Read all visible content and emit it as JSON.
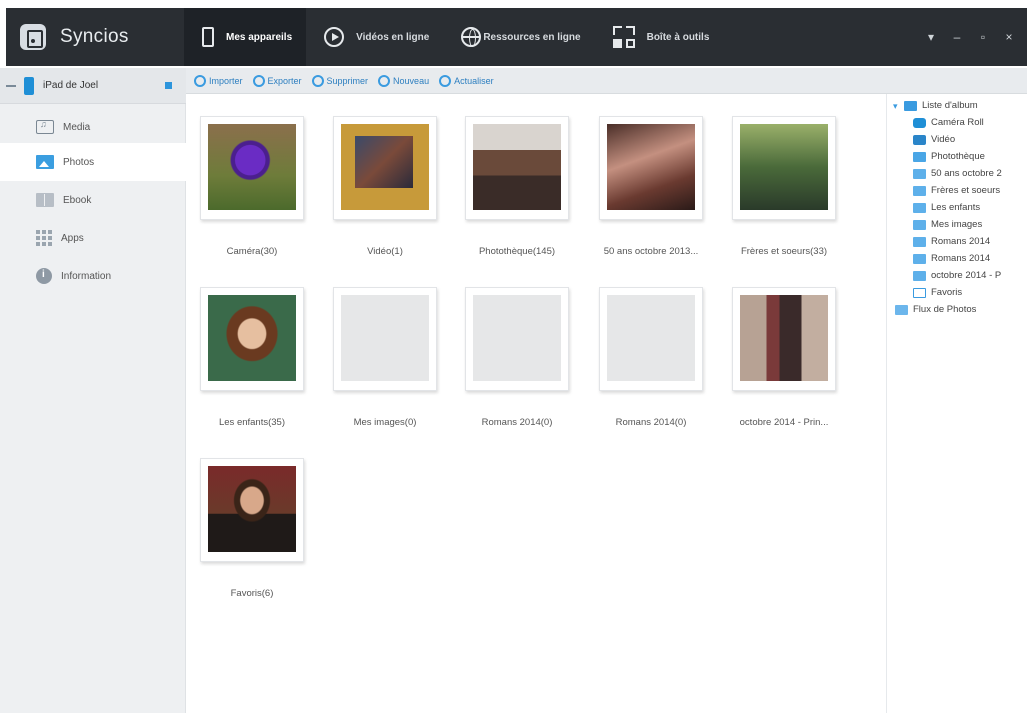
{
  "app": {
    "name": "Syncios"
  },
  "nav": {
    "items": [
      {
        "label": "Mes appareils",
        "icon": "phone-icon",
        "active": true
      },
      {
        "label": "Vidéos en ligne",
        "icon": "play-icon",
        "active": false
      },
      {
        "label": "Ressources en ligne",
        "icon": "globe-icon",
        "active": false
      },
      {
        "label": "Boîte à outils",
        "icon": "toolbox-icon",
        "active": false
      }
    ]
  },
  "window_controls": {
    "menu": "▾",
    "minimize": "–",
    "maximize": "▫",
    "close": "×"
  },
  "sidebar": {
    "device_name": "iPad de Joel",
    "items": [
      {
        "label": "Media",
        "icon": "music-icon",
        "active": false
      },
      {
        "label": "Photos",
        "icon": "photo-icon",
        "active": true
      },
      {
        "label": "Ebook",
        "icon": "book-icon",
        "active": false
      },
      {
        "label": "Apps",
        "icon": "apps-icon",
        "active": false
      },
      {
        "label": "Information",
        "icon": "info-icon",
        "active": false
      }
    ]
  },
  "toolbar": {
    "buttons": [
      {
        "label": "Importer"
      },
      {
        "label": "Exporter"
      },
      {
        "label": "Supprimer"
      },
      {
        "label": "Nouveau"
      },
      {
        "label": "Actualiser"
      }
    ]
  },
  "albums": [
    {
      "caption": "Caméra(30)",
      "thumb": "flower"
    },
    {
      "caption": "Vidéo(1)",
      "thumb": "video"
    },
    {
      "caption": "Photothèque(145)",
      "thumb": "photolib"
    },
    {
      "caption": "50 ans octobre 2013...",
      "thumb": "group"
    },
    {
      "caption": "Frères et soeurs(33)",
      "thumb": "couple"
    },
    {
      "caption": "Les enfants(35)",
      "thumb": "girl"
    },
    {
      "caption": "Mes images(0)",
      "thumb": "empty"
    },
    {
      "caption": "Romans 2014(0)",
      "thumb": "empty"
    },
    {
      "caption": "Romans 2014(0)",
      "thumb": "empty"
    },
    {
      "caption": "octobre 2014 - Prin...",
      "thumb": "people"
    },
    {
      "caption": "Favoris(6)",
      "thumb": "boy"
    }
  ],
  "tree": {
    "root_label": "Liste d'album",
    "items": [
      {
        "label": "Caméra Roll",
        "icon": "camera-icon"
      },
      {
        "label": "Vidéo",
        "icon": "video-icon"
      },
      {
        "label": "Photothèque",
        "icon": "album-icon"
      },
      {
        "label": "50 ans octobre 2",
        "icon": "album-icon"
      },
      {
        "label": "Frères et soeurs",
        "icon": "album-icon"
      },
      {
        "label": "Les enfants",
        "icon": "album-icon"
      },
      {
        "label": "Mes images",
        "icon": "album-icon"
      },
      {
        "label": "Romans 2014",
        "icon": "album-icon"
      },
      {
        "label": "Romans 2014",
        "icon": "album-icon"
      },
      {
        "label": "octobre 2014 - P",
        "icon": "album-icon"
      },
      {
        "label": "Favoris",
        "icon": "star-icon"
      }
    ],
    "stream_label": "Flux de Photos"
  },
  "colors": {
    "titlebar": "#2a2e33",
    "accent": "#3a9be0",
    "sidebar_bg": "#eef0f2"
  }
}
